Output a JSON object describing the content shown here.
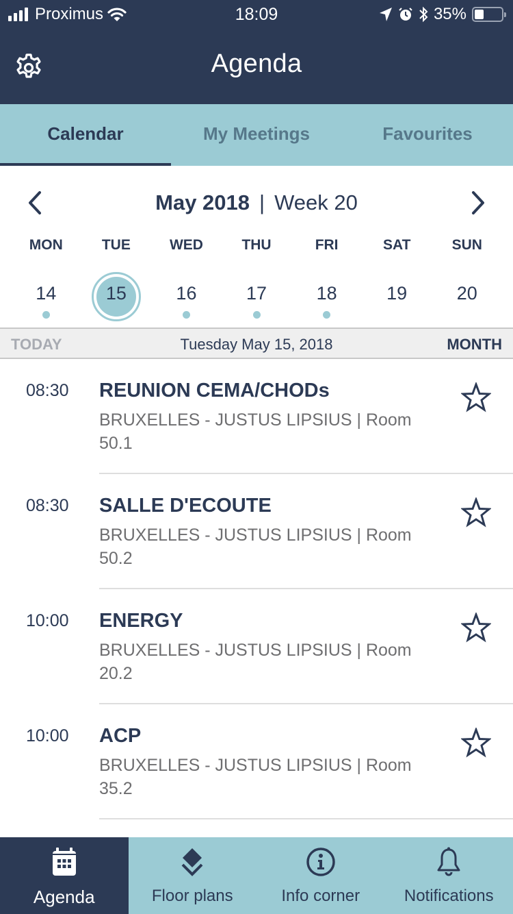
{
  "status_bar": {
    "carrier": "Proximus",
    "time": "18:09",
    "battery_percent": "35%",
    "battery_level": 0.35
  },
  "header": {
    "title": "Agenda",
    "settings_icon": "gear-icon"
  },
  "tabs": [
    {
      "label": "Calendar",
      "active": true
    },
    {
      "label": "My Meetings",
      "active": false
    },
    {
      "label": "Favourites",
      "active": false
    }
  ],
  "calendar": {
    "month_label": "May 2018",
    "separator": "|",
    "week_label": "Week 20",
    "prev_icon": "chevron-left-icon",
    "next_icon": "chevron-right-icon",
    "weekdays": [
      "MON",
      "TUE",
      "WED",
      "THU",
      "FRI",
      "SAT",
      "SUN"
    ],
    "dates": [
      {
        "day": "14",
        "has_events": true,
        "selected": false
      },
      {
        "day": "15",
        "has_events": false,
        "selected": true
      },
      {
        "day": "16",
        "has_events": true,
        "selected": false
      },
      {
        "day": "17",
        "has_events": true,
        "selected": false
      },
      {
        "day": "18",
        "has_events": true,
        "selected": false
      },
      {
        "day": "19",
        "has_events": false,
        "selected": false
      },
      {
        "day": "20",
        "has_events": false,
        "selected": false
      }
    ]
  },
  "today_bar": {
    "today_label": "TODAY",
    "selected_date": "Tuesday May 15, 2018",
    "month_label": "MONTH"
  },
  "meetings": [
    {
      "time": "08:30",
      "name": "REUNION CEMA/CHODs",
      "location": "BRUXELLES - JUSTUS LIPSIUS | Room 50.1",
      "favourite": false
    },
    {
      "time": "08:30",
      "name": "SALLE D'ECOUTE",
      "location": "BRUXELLES - JUSTUS LIPSIUS | Room 50.2",
      "favourite": false
    },
    {
      "time": "10:00",
      "name": "ENERGY",
      "location": "BRUXELLES - JUSTUS LIPSIUS | Room 20.2",
      "favourite": false
    },
    {
      "time": "10:00",
      "name": "ACP",
      "location": "BRUXELLES - JUSTUS LIPSIUS | Room 35.2",
      "favourite": false
    }
  ],
  "bottom_nav": [
    {
      "label": "Agenda",
      "icon": "calendar-icon",
      "active": true
    },
    {
      "label": "Floor plans",
      "icon": "layers-icon",
      "active": false
    },
    {
      "label": "Info corner",
      "icon": "info-icon",
      "active": false
    },
    {
      "label": "Notifications",
      "icon": "bell-icon",
      "active": false
    }
  ],
  "colors": {
    "primary": "#2c3a55",
    "accent": "#9bcbd4",
    "muted_text": "#6e6e70",
    "today_bar_bg": "#efefef"
  }
}
